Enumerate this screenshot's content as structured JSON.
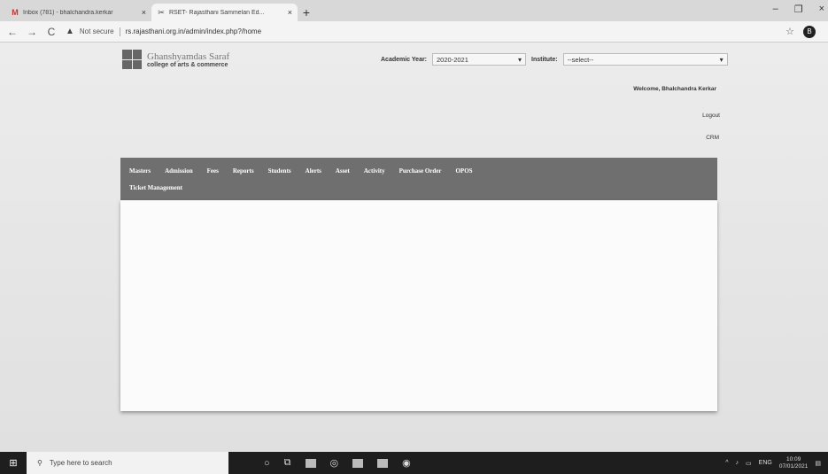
{
  "browser": {
    "tabs": [
      {
        "title": "Inbox (781) - bhalchandra.kerkar",
        "icon": "gmail-icon",
        "close": "×"
      },
      {
        "title": "RSET- Rajasthani Sammelan Ed...",
        "icon": "site-icon",
        "close": "×"
      }
    ],
    "new_tab": "+",
    "window_controls": {
      "minimize": "–",
      "restore": "❐",
      "close": "×"
    },
    "nav": {
      "back": "←",
      "forward": "→",
      "reload": "C"
    },
    "security_label": "Not secure",
    "url": "rs.rajasthani.org.in/admin/index.php?/home",
    "profile_initial": "B"
  },
  "header": {
    "logo_line1": "Ghanshyamdas Saraf",
    "logo_line2": "college of arts & commerce",
    "academic_year_label": "Academic Year:",
    "academic_year_value": "2020-2021",
    "institute_label": "Institute:",
    "institute_value": "--select--",
    "welcome": "Welcome, Bhalchandra Kerkar",
    "logout": "Logout",
    "crm": "CRM"
  },
  "menu": {
    "row1": [
      "Masters",
      "Admission",
      "Fees",
      "Reports",
      "Students",
      "Alerts",
      "Asset",
      "Activity",
      "Purchase Order",
      "OPOS"
    ],
    "row2": [
      "Ticket Management"
    ]
  },
  "taskbar": {
    "search_placeholder": "Type here to search",
    "tray_lang": "ENG",
    "time": "10:09",
    "date": "07/01/2021"
  },
  "colors": {
    "menu_bg": "#6f6f6f",
    "page_bg": "#e9e9e9",
    "taskbar_bg": "#1e1e1e"
  }
}
